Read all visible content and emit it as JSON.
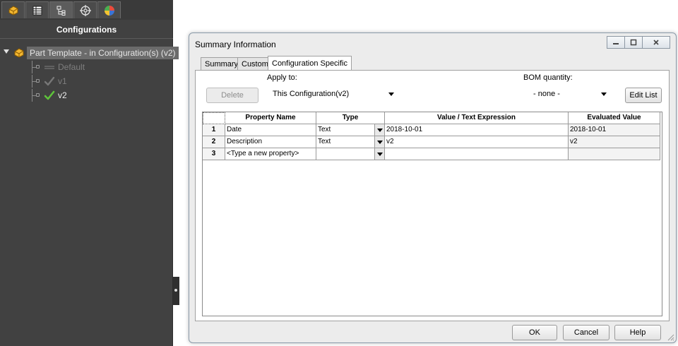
{
  "panel": {
    "title": "Configurations",
    "tabs": [
      {
        "name": "feature-manager",
        "icon": "part-feature-icon"
      },
      {
        "name": "property-manager",
        "icon": "property-list-icon"
      },
      {
        "name": "configuration-manager",
        "icon": "configuration-tree-icon"
      },
      {
        "name": "dimxpert-manager",
        "icon": "crosshair-target-icon"
      },
      {
        "name": "display-manager",
        "icon": "appearance-pie-icon"
      }
    ],
    "tree": {
      "root_label": "Part Template - in Configuration(s)  (v2)",
      "items": [
        {
          "label": "Default",
          "state": "inactive"
        },
        {
          "label": "v1",
          "state": "inactive"
        },
        {
          "label": "v2",
          "state": "active"
        }
      ]
    }
  },
  "dialog": {
    "title": "Summary Information",
    "window_buttons": [
      "minimize",
      "maximize",
      "close"
    ],
    "tabs": [
      "Summary",
      "Custom",
      "Configuration Specific"
    ],
    "active_tab": "Configuration Specific",
    "apply_to_label": "Apply to:",
    "apply_to_value": "This Configuration(v2)",
    "delete_label": "Delete",
    "bom_label": "BOM quantity:",
    "bom_value": "- none -",
    "edit_list_label": "Edit List",
    "grid": {
      "columns": [
        "Property Name",
        "Type",
        "Value / Text Expression",
        "Evaluated Value"
      ],
      "rows": [
        {
          "num": "1",
          "name": "Date",
          "type": "Text",
          "value": "2018-10-01",
          "evaluated": "2018-10-01"
        },
        {
          "num": "2",
          "name": "Description",
          "type": "Text",
          "value": "v2",
          "evaluated": "v2"
        },
        {
          "num": "3",
          "name": "<Type a new property>",
          "type": "",
          "value": "",
          "evaluated": ""
        }
      ]
    },
    "ok_label": "OK",
    "cancel_label": "Cancel",
    "help_label": "Help"
  },
  "colors": {
    "panel_bg": "#414141",
    "panel_text": "#ececec",
    "selection_bg": "#6b6b6b",
    "check_green": "#5ec33a",
    "dialog_bg": "#ececec"
  }
}
